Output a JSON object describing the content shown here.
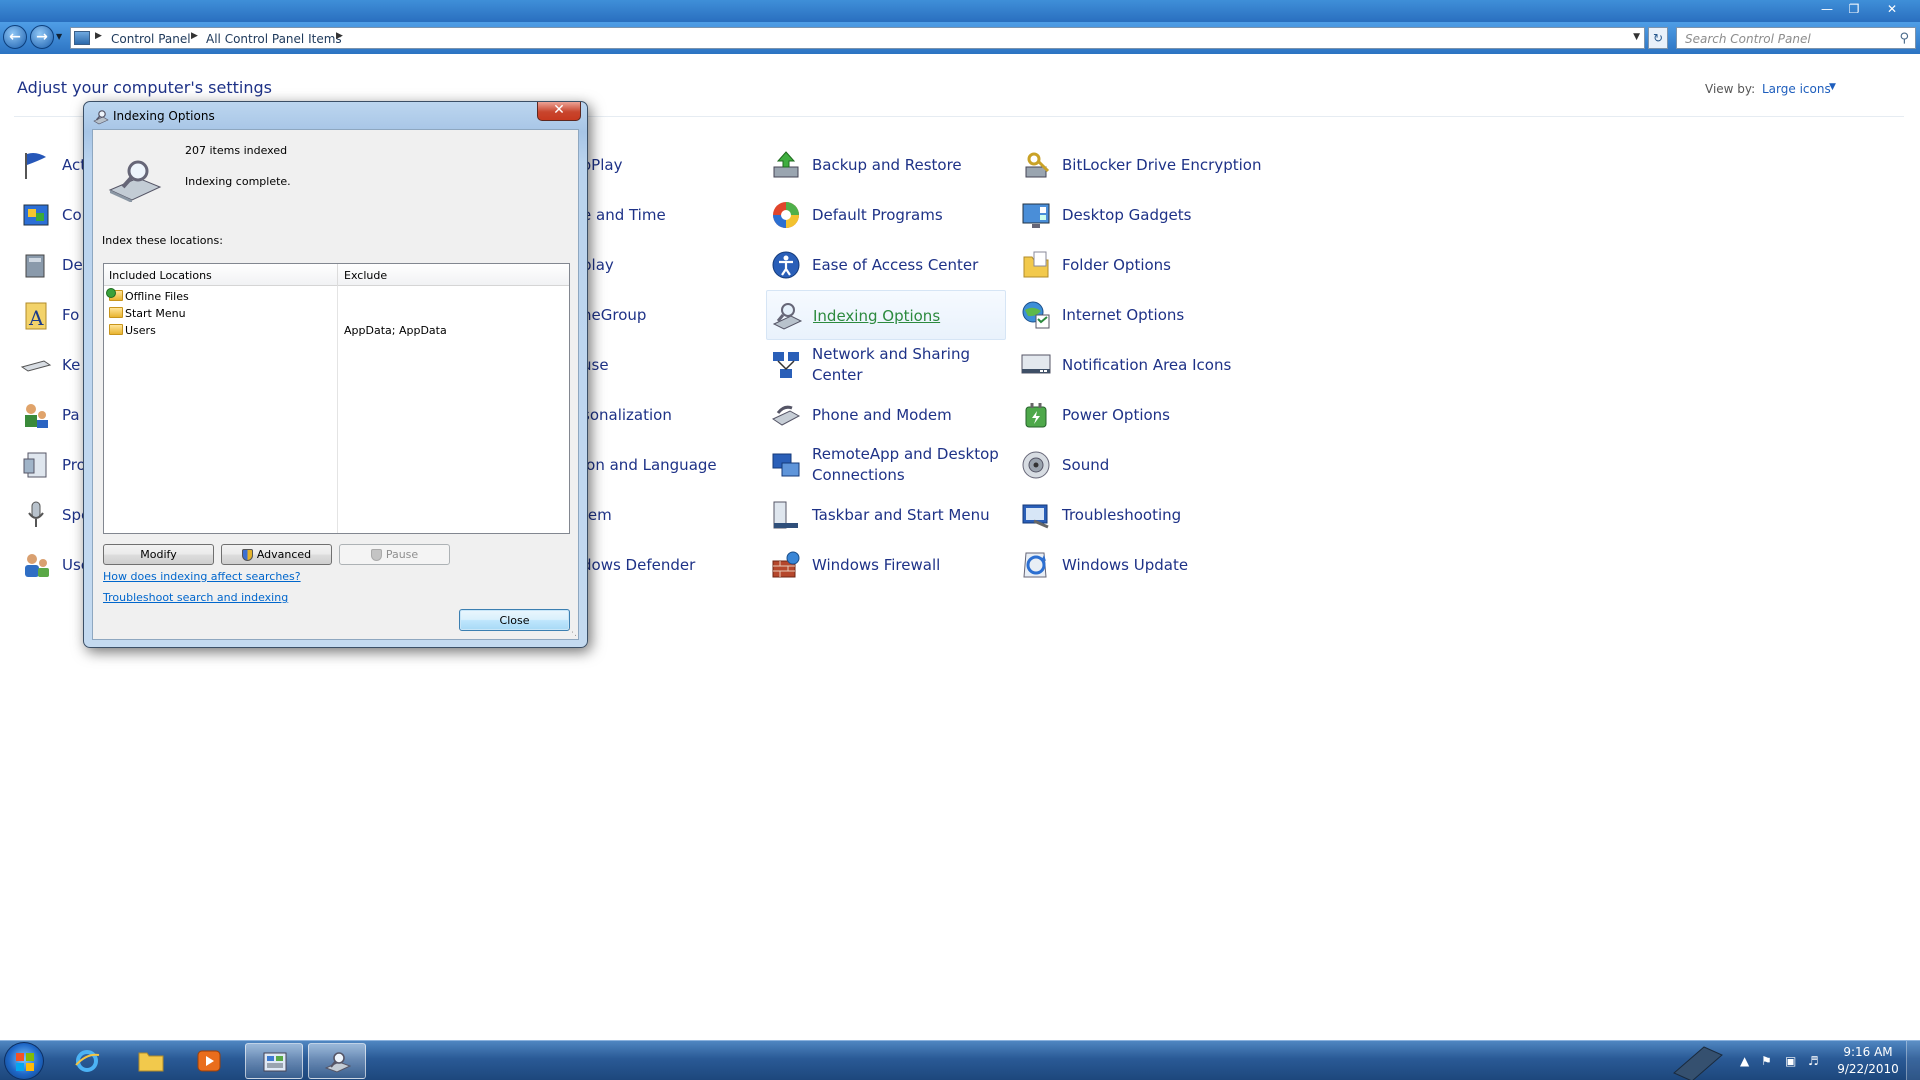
{
  "breadcrumb": [
    "Control Panel",
    "All Control Panel Items"
  ],
  "search": {
    "placeholder": "Search Control Panel"
  },
  "heading": "Adjust your computer's settings",
  "view_by": {
    "label": "View by:",
    "value": "Large icons"
  },
  "items_col1": [
    "Act",
    "Co",
    "De",
    "Fo",
    "Ke",
    "Pa",
    "Pro",
    "Spe",
    "Use"
  ],
  "items_col2": [
    "oPlay",
    "e and Time",
    "play",
    "neGroup",
    "use",
    "sonalization",
    "ion and Language",
    "tem",
    "dows Defender"
  ],
  "items_col3": [
    {
      "label": "Backup and Restore",
      "icon": "backup-icon"
    },
    {
      "label": "Default Programs",
      "icon": "default-programs-icon"
    },
    {
      "label": "Ease of Access Center",
      "icon": "ease-of-access-icon"
    },
    {
      "label": "Indexing Options",
      "icon": "indexing-icon"
    },
    {
      "label": "Network and Sharing Center",
      "icon": "network-icon"
    },
    {
      "label": "Phone and Modem",
      "icon": "phone-icon"
    },
    {
      "label": "RemoteApp and Desktop Connections",
      "icon": "remoteapp-icon"
    },
    {
      "label": "Taskbar and Start Menu",
      "icon": "taskbar-icon"
    },
    {
      "label": "Windows Firewall",
      "icon": "firewall-icon"
    }
  ],
  "items_col4": [
    {
      "label": "BitLocker Drive Encryption",
      "icon": "bitlocker-icon"
    },
    {
      "label": "Desktop Gadgets",
      "icon": "gadgets-icon"
    },
    {
      "label": "Folder Options",
      "icon": "folder-options-icon"
    },
    {
      "label": "Internet Options",
      "icon": "internet-options-icon"
    },
    {
      "label": "Notification Area Icons",
      "icon": "notification-icon"
    },
    {
      "label": "Power Options",
      "icon": "power-icon"
    },
    {
      "label": "Sound",
      "icon": "sound-icon"
    },
    {
      "label": "Troubleshooting",
      "icon": "troubleshooting-icon"
    },
    {
      "label": "Windows Update",
      "icon": "windows-update-icon"
    }
  ],
  "dialog": {
    "title": "Indexing Options",
    "items_indexed": "207 items indexed",
    "status": "Indexing complete.",
    "locations_label": "Index these locations:",
    "columns": [
      "Included Locations",
      "Exclude"
    ],
    "rows": [
      {
        "name": "Offline Files",
        "exclude": ""
      },
      {
        "name": "Start Menu",
        "exclude": ""
      },
      {
        "name": "Users",
        "exclude": "AppData; AppData"
      }
    ],
    "buttons": {
      "modify": "Modify",
      "advanced": "Advanced",
      "pause": "Pause",
      "close": "Close"
    },
    "links": [
      "How does indexing affect searches?",
      "Troubleshoot search and indexing"
    ]
  },
  "clock": {
    "time": "9:16 AM",
    "date": "9/22/2010"
  },
  "colors": {
    "link": "#1e3287",
    "hover_link": "#2c8a3e",
    "dialog_link": "#0066cc",
    "taskbar": "#2a5a96"
  }
}
